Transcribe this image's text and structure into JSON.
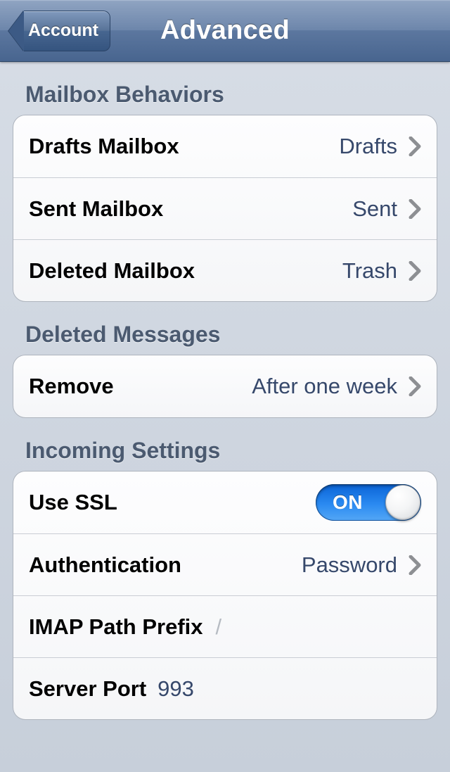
{
  "nav": {
    "back_label": "Account",
    "title": "Advanced"
  },
  "sections": {
    "mailbox_behaviors": {
      "header": "Mailbox Behaviors",
      "drafts": {
        "label": "Drafts Mailbox",
        "value": "Drafts"
      },
      "sent": {
        "label": "Sent Mailbox",
        "value": "Sent"
      },
      "deleted": {
        "label": "Deleted Mailbox",
        "value": "Trash"
      }
    },
    "deleted_messages": {
      "header": "Deleted Messages",
      "remove": {
        "label": "Remove",
        "value": "After one week"
      }
    },
    "incoming": {
      "header": "Incoming Settings",
      "use_ssl": {
        "label": "Use SSL",
        "on_text": "ON",
        "value": true
      },
      "authentication": {
        "label": "Authentication",
        "value": "Password"
      },
      "imap_prefix": {
        "label": "IMAP Path Prefix",
        "placeholder": "/"
      },
      "server_port": {
        "label": "Server Port",
        "value": "993"
      }
    }
  }
}
